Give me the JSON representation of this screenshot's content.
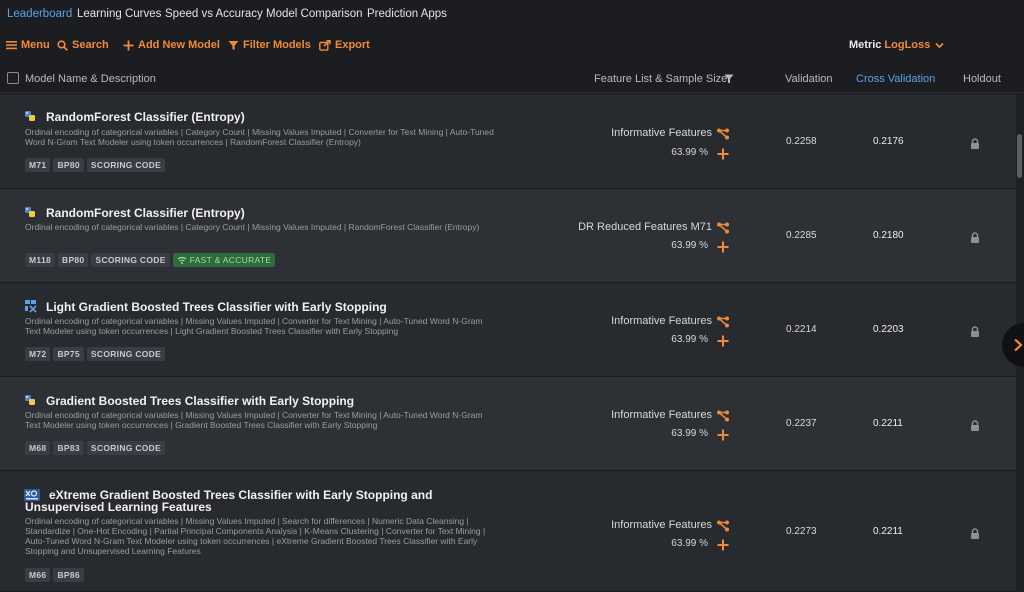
{
  "nav": {
    "tabs": [
      "Leaderboard",
      "Learning Curves",
      "Speed vs Accuracy",
      "Model Comparison",
      "Prediction Apps"
    ],
    "active": "Leaderboard"
  },
  "toolbar": {
    "menu": "Menu",
    "search": "Search",
    "add": "Add New Model",
    "filter": "Filter Models",
    "export": "Export",
    "metric_label": "Metric",
    "metric_value": "LogLoss"
  },
  "columns": {
    "name": "Model Name & Description",
    "features": "Feature List & Sample Size",
    "validation": "Validation",
    "cv": "Cross Validation",
    "holdout": "Holdout"
  },
  "colors": {
    "accent": "#f08a3a",
    "link": "#5da2e6"
  },
  "models": [
    {
      "title": "RandomForest Classifier (Entropy)",
      "icon": "python-icon",
      "desc": "Ordinal encoding of categorical variables | Category Count | Missing Values Imputed | Converter for Text Mining | Auto-Tuned Word N-Gram Text Modeler using token occurrences | RandomForest Classifier (Entropy)",
      "tags": [
        "M71",
        "BP80",
        "SCORING CODE"
      ],
      "badge": "",
      "feature_list": "Informative Features",
      "sample": "63.99 %",
      "validation": "0.2258",
      "cv": "0.2176"
    },
    {
      "title": "RandomForest Classifier (Entropy)",
      "icon": "python-icon",
      "desc": "Ordinal encoding of categorical variables | Category Count | Missing Values Imputed | RandomForest Classifier (Entropy)",
      "tags": [
        "M118",
        "BP80",
        "SCORING CODE"
      ],
      "badge": "FAST & ACCURATE",
      "feature_list": "DR Reduced Features M71",
      "sample": "63.99 %",
      "validation": "0.2285",
      "cv": "0.2180"
    },
    {
      "title": "Light Gradient Boosted Trees Classifier with Early Stopping",
      "icon": "lightgbm-icon",
      "desc": "Ordinal encoding of categorical variables | Missing Values Imputed | Converter for Text Mining | Auto-Tuned Word N-Gram Text Modeler using token occurrences | Light Gradient Boosted Trees Classifier with Early Stopping",
      "tags": [
        "M72",
        "BP75",
        "SCORING CODE"
      ],
      "badge": "",
      "feature_list": "Informative Features",
      "sample": "63.99 %",
      "validation": "0.2214",
      "cv": "0.2203"
    },
    {
      "title": "Gradient Boosted Trees Classifier with Early Stopping",
      "icon": "python-icon",
      "desc": "Ordinal encoding of categorical variables | Missing Values Imputed | Converter for Text Mining | Auto-Tuned Word N-Gram Text Modeler using token occurrences | Gradient Boosted Trees Classifier with Early Stopping",
      "tags": [
        "M68",
        "BP83",
        "SCORING CODE"
      ],
      "badge": "",
      "feature_list": "Informative Features",
      "sample": "63.99 %",
      "validation": "0.2237",
      "cv": "0.2211"
    },
    {
      "title": "eXtreme Gradient Boosted Trees Classifier with Early Stopping and Unsupervised Learning Features",
      "icon": "xgboost-icon",
      "desc": "Ordinal encoding of categorical variables | Missing Values Imputed | Search for differences | Numeric Data Cleansing | Standardize | One-Hot Encoding | Partial Principal Components Analysis | K-Means Clustering | Converter for Text Mining | Auto-Tuned Word N-Gram Text Modeler using token occurrences | eXtreme Gradient Boosted Trees Classifier with Early Stopping and Unsupervised Learning Features",
      "tags": [
        "M66",
        "BP86"
      ],
      "badge": "",
      "feature_list": "Informative Features",
      "sample": "63.99 %",
      "validation": "0.2273",
      "cv": "0.2211"
    }
  ]
}
